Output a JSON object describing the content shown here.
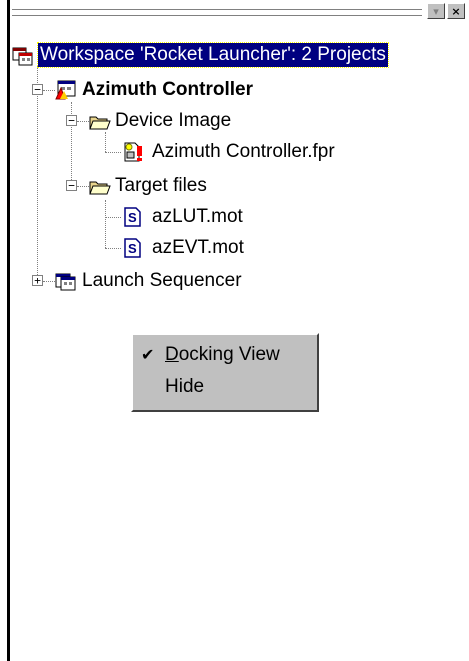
{
  "tree": {
    "workspace": {
      "label": "Workspace 'Rocket Launcher': 2 Projects",
      "icon": "workspace-icon"
    },
    "project1": {
      "label": "Azimuth Controller",
      "icon": "project-icon"
    },
    "device_image": {
      "label": "Device Image",
      "icon": "folder-open-icon"
    },
    "fpr_file": {
      "label": "Azimuth Controller.fpr",
      "icon": "device-image-file-icon"
    },
    "target_files": {
      "label": "Target files",
      "icon": "folder-open-icon"
    },
    "file1": {
      "label": "azLUT.mot",
      "icon": "srecord-file-icon"
    },
    "file2": {
      "label": "azEVT.mot",
      "icon": "srecord-file-icon"
    },
    "project2": {
      "label": "Launch Sequencer",
      "icon": "project-icon"
    }
  },
  "context_menu": {
    "docking_view": {
      "label_underlined": "D",
      "label_rest": "ocking View",
      "checked": true
    },
    "hide": {
      "label": "Hide"
    }
  },
  "colors": {
    "selection": "#000080",
    "menu_bg": "#c0c0c0"
  }
}
